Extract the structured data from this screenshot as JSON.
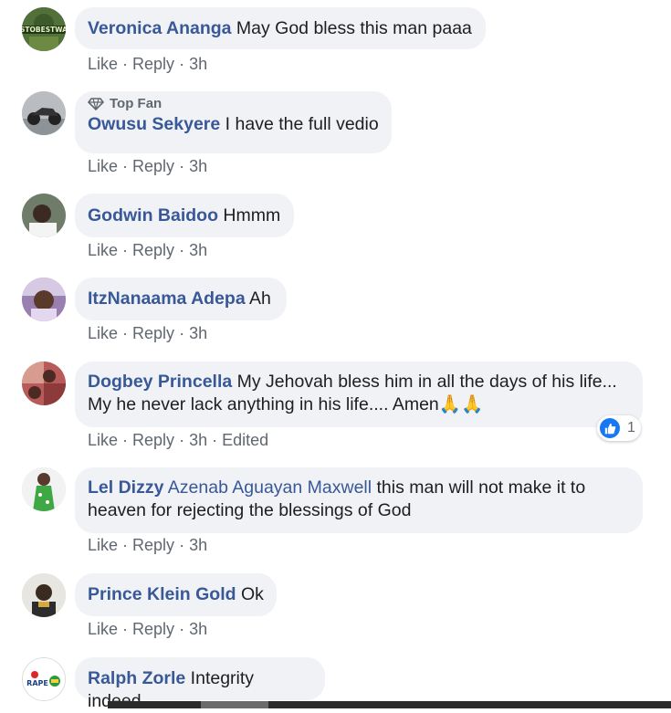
{
  "comments": [
    {
      "author": "Veronica Ananga",
      "text": " May God bless this man paaa",
      "like": "Like",
      "reply": "Reply",
      "time": "3h",
      "avatar_text": "STOBESTWA"
    },
    {
      "badge": "Top Fan",
      "author": "Owusu Sekyere",
      "text": " I have the full vedio",
      "like": "Like",
      "reply": "Reply",
      "time": "3h"
    },
    {
      "author": "Godwin Baidoo",
      "text": " Hmmm",
      "like": "Like",
      "reply": "Reply",
      "time": "3h"
    },
    {
      "author": "ItzNanaama Adepa",
      "text": " Ah",
      "like": "Like",
      "reply": "Reply",
      "time": "3h"
    },
    {
      "author": "Dogbey Princella",
      "text": " My Jehovah bless him in all the days of his life... My he never lack anything in his life.... Amen🙏🙏",
      "like": "Like",
      "reply": "Reply",
      "time": "3h",
      "edited": "Edited",
      "reaction_count": "1"
    },
    {
      "author": "Lel Dizzy",
      "mention": "Azenab Aguayan Maxwell",
      "text": " this man will not make it to heaven for rejecting the blessings of God",
      "like": "Like",
      "reply": "Reply",
      "time": "3h"
    },
    {
      "author": "Prince Klein Gold",
      "text": " Ok",
      "like": "Like",
      "reply": "Reply",
      "time": "3h"
    },
    {
      "author": "Ralph Zorle",
      "text": " Integrity indeed",
      "avatar_text": "RAPE"
    }
  ],
  "separator": "·",
  "colors": {
    "name": "#385898",
    "bubble": "#f0f2f5",
    "meta": "#606770",
    "like_blue": "#1877f2"
  }
}
